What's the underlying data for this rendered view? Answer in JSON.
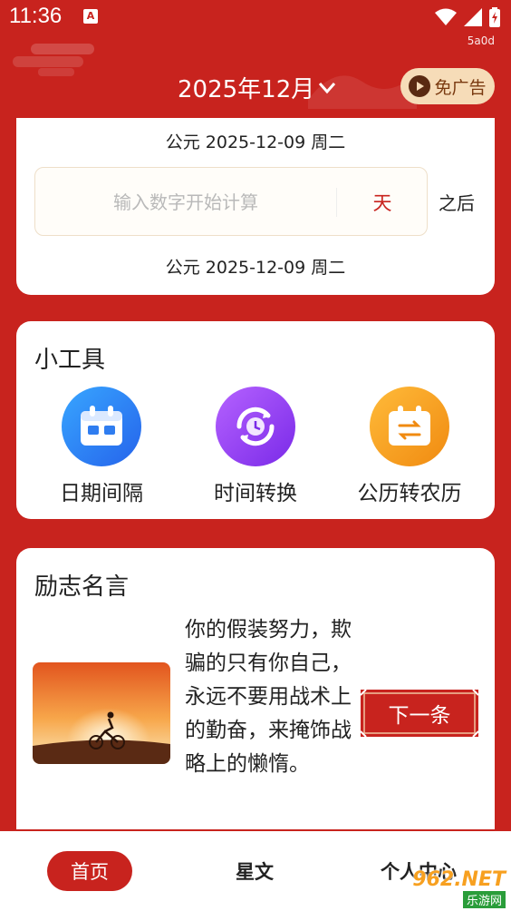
{
  "status": {
    "time": "11:36",
    "sim_icon": "A",
    "id_text": "5a0d",
    "icons": [
      "wifi-icon",
      "signal-icon",
      "battery-icon"
    ]
  },
  "header": {
    "month": "2025年12月",
    "ad_button": "免广告"
  },
  "calculator": {
    "date_top": "公元 2025-12-09 周二",
    "input_placeholder": "输入数字开始计算",
    "input_value": "",
    "unit": "天",
    "direction": "之后",
    "date_bottom": "公元 2025-12-09 周二"
  },
  "tools": {
    "title": "小工具",
    "items": [
      {
        "label": "日期间隔",
        "icon": "calendar-icon"
      },
      {
        "label": "时间转换",
        "icon": "clock-convert-icon"
      },
      {
        "label": "公历转农历",
        "icon": "calendar-swap-icon"
      }
    ]
  },
  "quotes": {
    "title": "励志名言",
    "text": "你的假装努力，欺骗的只有你自己，永远不要用战术上的勤奋，来掩饰战略上的懒惰。",
    "next_button": "下一条"
  },
  "nav": {
    "items": [
      "首页",
      "星文",
      "个人中心"
    ],
    "active": "首页"
  },
  "watermark": {
    "text": "962.NET",
    "subtext": "乐游网"
  },
  "colors": {
    "primary": "#c8231e",
    "ad_bg": "#f6dcb8",
    "tool_blue": "#2f7df0",
    "tool_purple": "#8a3ff0",
    "tool_orange": "#f39a1a"
  }
}
